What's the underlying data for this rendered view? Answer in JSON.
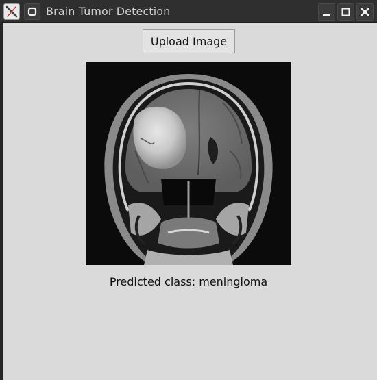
{
  "window": {
    "title": "Brain Tumor Detection",
    "colors": {
      "titlebar": "#2f2f2f",
      "background": "#dadada"
    }
  },
  "titlebar_icons": {
    "app": "x-logo-icon",
    "menu": "window-menu-icon",
    "minimize": "minimize-icon",
    "maximize": "maximize-icon",
    "close": "close-icon"
  },
  "toolbar": {
    "upload_label": "Upload Image"
  },
  "image": {
    "description_icon": "mri-brain-scan-image"
  },
  "result": {
    "prediction_text": "Predicted class: meningioma"
  }
}
